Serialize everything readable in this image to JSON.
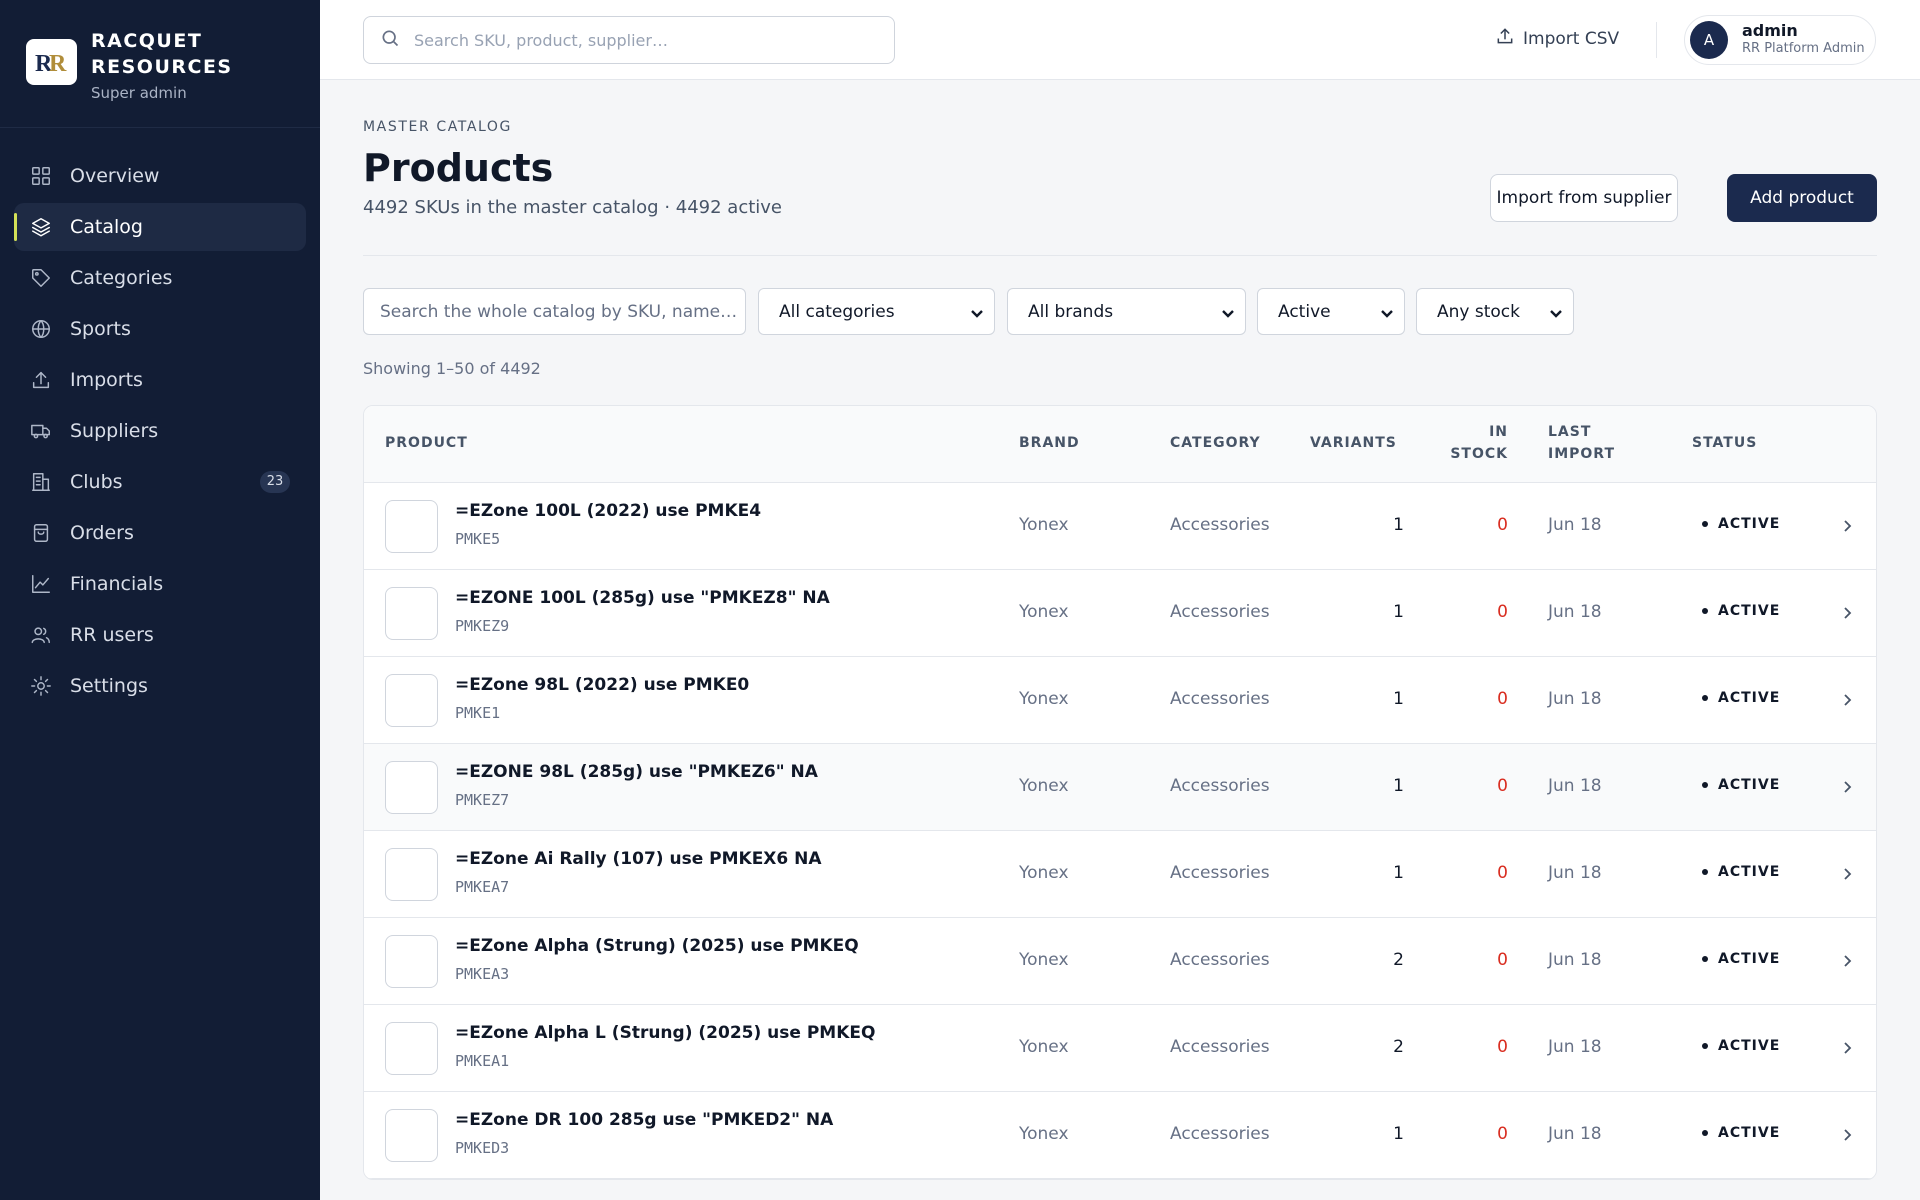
{
  "app": {
    "brand_name_line1": "RACQUET",
    "brand_name_line2": "RESOURCES",
    "brand_role": "Super admin"
  },
  "sidebar": {
    "items": [
      {
        "label": "Overview",
        "icon": "grid-icon"
      },
      {
        "label": "Catalog",
        "icon": "layers-icon",
        "active": true
      },
      {
        "label": "Categories",
        "icon": "tag-icon"
      },
      {
        "label": "Sports",
        "icon": "globe-icon"
      },
      {
        "label": "Imports",
        "icon": "upload-icon"
      },
      {
        "label": "Suppliers",
        "icon": "truck-icon"
      },
      {
        "label": "Clubs",
        "icon": "building-icon",
        "badge": "23"
      },
      {
        "label": "Orders",
        "icon": "shopping-bag-icon"
      },
      {
        "label": "Financials",
        "icon": "line-chart-icon"
      },
      {
        "label": "RR users",
        "icon": "users-icon"
      },
      {
        "label": "Settings",
        "icon": "sun-gear-icon"
      }
    ]
  },
  "topbar": {
    "search_placeholder": "Search SKU, product, supplier…",
    "import_csv_label": "Import CSV",
    "user_initial": "A",
    "user_name": "admin",
    "user_role": "RR Platform Admin"
  },
  "page": {
    "eyebrow": "MASTER CATALOG",
    "title": "Products",
    "subtitle": "4492 SKUs in the master catalog · 4492 active",
    "import_supplier_label": "Import from supplier",
    "add_product_label": "Add product"
  },
  "filters": {
    "search_placeholder": "Search the whole catalog by SKU, name…",
    "category": "All categories",
    "brand": "All brands",
    "status": "Active",
    "stock": "Any stock",
    "showing": "Showing 1–50 of 4492"
  },
  "table": {
    "columns": {
      "product": "PRODUCT",
      "brand": "BRAND",
      "category": "CATEGORY",
      "variants": "VARIANTS",
      "in_stock_1": "IN",
      "in_stock_2": "STOCK",
      "last_import_1": "LAST",
      "last_import_2": "IMPORT",
      "status": "STATUS"
    },
    "rows": [
      {
        "name": "=EZone 100L (2022) use PMKE4",
        "sku": "PMKE5",
        "brand": "Yonex",
        "category": "Accessories",
        "variants": "1",
        "in_stock": "0",
        "last_import": "Jun 18",
        "status": "ACTIVE"
      },
      {
        "name": "=EZONE 100L (285g) use \"PMKEZ8\" NA",
        "sku": "PMKEZ9",
        "brand": "Yonex",
        "category": "Accessories",
        "variants": "1",
        "in_stock": "0",
        "last_import": "Jun 18",
        "status": "ACTIVE"
      },
      {
        "name": "=EZone 98L (2022) use PMKE0",
        "sku": "PMKE1",
        "brand": "Yonex",
        "category": "Accessories",
        "variants": "1",
        "in_stock": "0",
        "last_import": "Jun 18",
        "status": "ACTIVE"
      },
      {
        "name": "=EZONE 98L (285g) use \"PMKEZ6\" NA",
        "sku": "PMKEZ7",
        "brand": "Yonex",
        "category": "Accessories",
        "variants": "1",
        "in_stock": "0",
        "last_import": "Jun 18",
        "status": "ACTIVE"
      },
      {
        "name": "=EZone Ai Rally (107) use PMKEX6 NA",
        "sku": "PMKEA7",
        "brand": "Yonex",
        "category": "Accessories",
        "variants": "1",
        "in_stock": "0",
        "last_import": "Jun 18",
        "status": "ACTIVE"
      },
      {
        "name": "=EZone Alpha (Strung) (2025) use PMKEQ",
        "sku": "PMKEA3",
        "brand": "Yonex",
        "category": "Accessories",
        "variants": "2",
        "in_stock": "0",
        "last_import": "Jun 18",
        "status": "ACTIVE"
      },
      {
        "name": "=EZone Alpha L (Strung) (2025) use PMKEQ",
        "sku": "PMKEA1",
        "brand": "Yonex",
        "category": "Accessories",
        "variants": "2",
        "in_stock": "0",
        "last_import": "Jun 18",
        "status": "ACTIVE"
      },
      {
        "name": "=EZone DR 100 285g use \"PMKED2\" NA",
        "sku": "PMKED3",
        "brand": "Yonex",
        "category": "Accessories",
        "variants": "1",
        "in_stock": "0",
        "last_import": "Jun 18",
        "status": "ACTIVE"
      }
    ]
  },
  "colors": {
    "sidebar_bg": "#121d35",
    "primary": "#1b2a4e",
    "accent": "#d4e157",
    "stock_zero": "#d92d20"
  }
}
